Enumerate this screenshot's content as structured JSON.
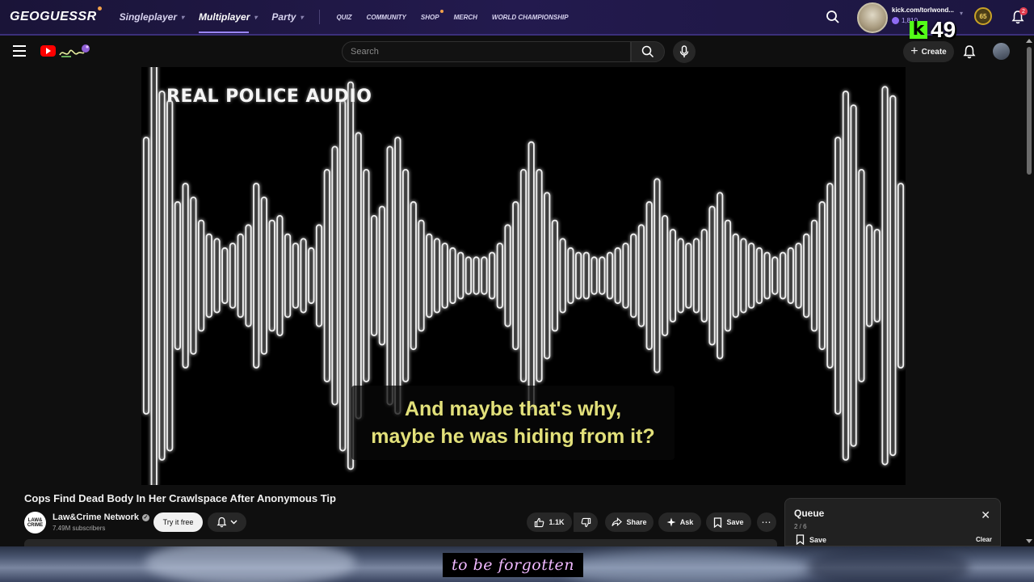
{
  "geoguessr": {
    "logo": "GEOGUESSR",
    "nav_main": [
      {
        "label": "Singleplayer",
        "active": false
      },
      {
        "label": "Multiplayer",
        "active": true
      },
      {
        "label": "Party",
        "active": false
      }
    ],
    "nav_small": [
      "QUIZ",
      "COMMUNITY",
      "SHOP",
      "MERCH",
      "WORLD CHAMPIONSHIP"
    ],
    "user": {
      "name": "kick.com/torlwond...",
      "coins": "1,810",
      "level": "65"
    },
    "notification_count": "2"
  },
  "kick_overlay": {
    "viewers": "49"
  },
  "youtube": {
    "search": {
      "placeholder": "Search"
    },
    "create_label": "Create",
    "video": {
      "overlay_title": "REAL POLICE AUDIO",
      "caption_lines": [
        "And maybe that's why,",
        "maybe he was hiding from it?"
      ]
    },
    "title": "Cops Find Dead Body In Her Crawlspace After Anonymous Tip",
    "channel": {
      "name": "Law&Crime Network",
      "logo_text": "LAW& CRIME",
      "subscribers": "7.49M subscribers"
    },
    "actions": {
      "try_label": "Try it free",
      "likes": "1.1K",
      "share": "Share",
      "ask": "Ask",
      "save": "Save"
    },
    "queue": {
      "title": "Queue",
      "count": "2 / 6",
      "save": "Save",
      "clear": "Clear"
    }
  },
  "stream_caption": "to be forgotten",
  "colors": {
    "accent_geo": "#9a86ff",
    "kick_green": "#53fc18",
    "caption_yellow": "#e2e07a",
    "stream_caption": "#f0b8ff"
  }
}
